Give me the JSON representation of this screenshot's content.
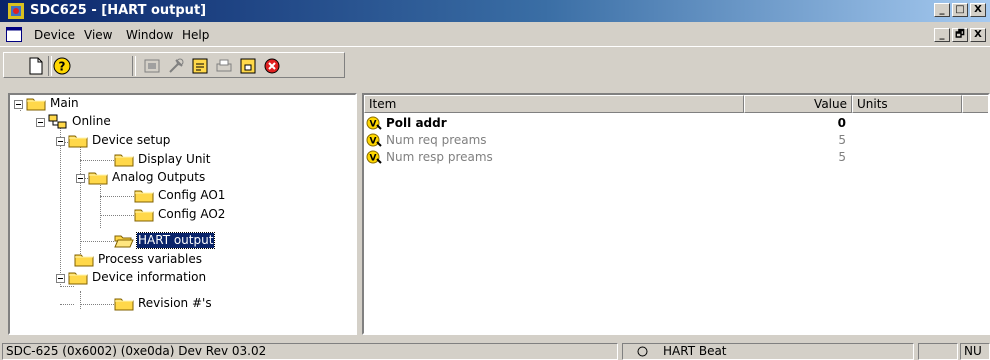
{
  "window": {
    "title": "SDC625 - [HART output]",
    "buttons": {
      "minimize": "_",
      "restore": "□",
      "close": "X"
    }
  },
  "mdi_buttons": {
    "minimize": "_",
    "restore": "🗗",
    "close": "X"
  },
  "menu": {
    "items": [
      "Device",
      "View",
      "Window",
      "Help"
    ]
  },
  "toolbar": {
    "buttons": [
      "new-icon",
      "help-icon",
      "device-icon",
      "tools-icon",
      "load-icon",
      "print-icon",
      "save-icon",
      "exit-icon"
    ]
  },
  "tree": {
    "nodes": [
      {
        "label": "Main"
      },
      {
        "label": "Online"
      },
      {
        "label": "Device setup"
      },
      {
        "label": "Display Unit"
      },
      {
        "label": "Analog Outputs"
      },
      {
        "label": "Config AO1"
      },
      {
        "label": "Config AO2"
      },
      {
        "label": "HART output",
        "selected": true
      },
      {
        "label": "Process variables"
      },
      {
        "label": "Device information"
      },
      {
        "label": "Revision #'s"
      }
    ]
  },
  "list": {
    "columns": [
      "Item",
      "Value",
      "Units"
    ],
    "rows": [
      {
        "name": "Poll addr",
        "value": "0",
        "units": "",
        "style": "bold"
      },
      {
        "name": "Num req preams",
        "value": "5",
        "units": "",
        "style": "gray"
      },
      {
        "name": "Num resp preams",
        "value": "5",
        "units": "",
        "style": "gray"
      }
    ]
  },
  "status": {
    "device": "SDC-625  (0x6002) (0xe0da) Dev Rev 03.02",
    "beat": "HART Beat",
    "num": "NU"
  },
  "colors": {
    "titlebar": "#0a246a",
    "folder": "#ffd84a",
    "selection": "#0a246a"
  }
}
